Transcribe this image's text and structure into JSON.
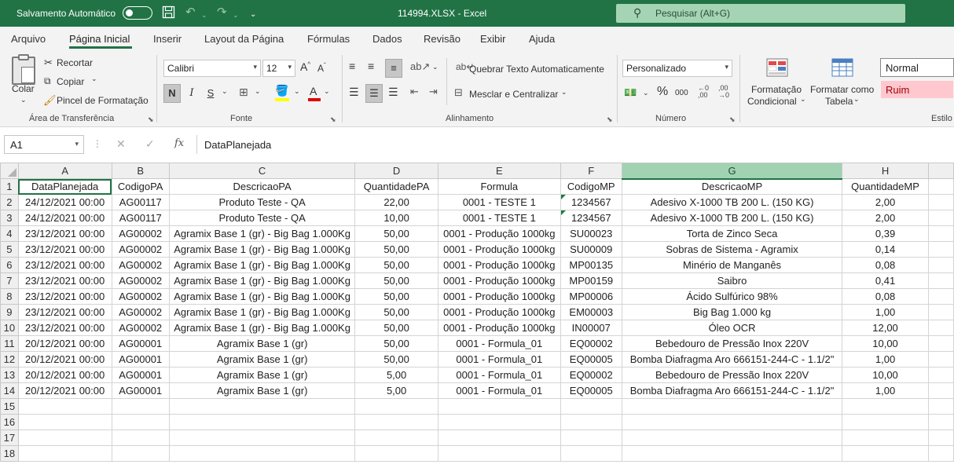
{
  "titlebar": {
    "autosave_label": "Salvamento Automático",
    "file_title": "114994.XLSX  -  Excel",
    "search_placeholder": "Pesquisar (Alt+G)"
  },
  "menu": {
    "tabs": [
      "Arquivo",
      "Página Inicial",
      "Inserir",
      "Layout da Página",
      "Fórmulas",
      "Dados",
      "Revisão",
      "Exibir",
      "Ajuda"
    ],
    "active": "Página Inicial"
  },
  "ribbon": {
    "clipboard": {
      "paste": "Colar",
      "cut": "Recortar",
      "copy": "Copiar",
      "format_painter": "Pincel de Formatação",
      "label": "Área de Transferência"
    },
    "font": {
      "name": "Calibri",
      "size": "12",
      "grow": "A",
      "shrink": "A",
      "bold": "N",
      "italic": "I",
      "underline": "S",
      "font_color_letter": "A",
      "label": "Fonte"
    },
    "alignment": {
      "wrap_text": "Quebrar Texto Automaticamente",
      "merge_center": "Mesclar e Centralizar",
      "label": "Alinhamento"
    },
    "number": {
      "format": "Personalizado",
      "percent": "%",
      "thousands": "000",
      "label": "Número"
    },
    "styles": {
      "conditional_line1": "Formatação",
      "conditional_line2": "Condicional",
      "table_line1": "Formatar como",
      "table_line2": "Tabela",
      "normal": "Normal",
      "bad": "Ruim",
      "label": "Estilo"
    }
  },
  "formula_bar": {
    "cell_ref": "A1",
    "fx": "fx",
    "value": "DataPlanejada"
  },
  "sheet": {
    "columns": [
      "A",
      "B",
      "C",
      "D",
      "E",
      "F",
      "G",
      "H"
    ],
    "selected_column": "G",
    "row_numbers": [
      "1",
      "2",
      "3",
      "4",
      "5",
      "6",
      "7",
      "8",
      "9",
      "10",
      "11",
      "12",
      "13",
      "14",
      "15",
      "16",
      "17",
      "18"
    ],
    "headers": [
      "DataPlanejada",
      "CodigoPA",
      "DescricaoPA",
      "QuantidadePA",
      "Formula",
      "CodigoMP",
      "DescricaoMP",
      "QuantidadeMP"
    ],
    "rows": [
      [
        "24/12/2021 00:00",
        "AG00117",
        "Produto Teste - QA",
        "22,00",
        "0001 - TESTE 1",
        "1234567",
        "Adesivo X-1000 TB 200 L. (150 KG)",
        "2,00"
      ],
      [
        "24/12/2021 00:00",
        "AG00117",
        "Produto Teste - QA",
        "10,00",
        "0001 - TESTE 1",
        "1234567",
        "Adesivo X-1000 TB 200 L. (150 KG)",
        "2,00"
      ],
      [
        "23/12/2021 00:00",
        "AG00002",
        "Agramix Base 1 (gr) - Big Bag 1.000Kg",
        "50,00",
        "0001 - Produção 1000kg",
        "SU00023",
        "Torta de Zinco Seca",
        "0,39"
      ],
      [
        "23/12/2021 00:00",
        "AG00002",
        "Agramix Base 1 (gr) - Big Bag 1.000Kg",
        "50,00",
        "0001 - Produção 1000kg",
        "SU00009",
        "Sobras de Sistema - Agramix",
        "0,14"
      ],
      [
        "23/12/2021 00:00",
        "AG00002",
        "Agramix Base 1 (gr) - Big Bag 1.000Kg",
        "50,00",
        "0001 - Produção 1000kg",
        "MP00135",
        "Minério de Manganês",
        "0,08"
      ],
      [
        "23/12/2021 00:00",
        "AG00002",
        "Agramix Base 1 (gr) - Big Bag 1.000Kg",
        "50,00",
        "0001 - Produção 1000kg",
        "MP00159",
        "Saibro",
        "0,41"
      ],
      [
        "23/12/2021 00:00",
        "AG00002",
        "Agramix Base 1 (gr) - Big Bag 1.000Kg",
        "50,00",
        "0001 - Produção 1000kg",
        "MP00006",
        "Ácido Sulfúrico 98%",
        "0,08"
      ],
      [
        "23/12/2021 00:00",
        "AG00002",
        "Agramix Base 1 (gr) - Big Bag 1.000Kg",
        "50,00",
        "0001 - Produção 1000kg",
        "EM00003",
        "Big Bag 1.000 kg",
        "1,00"
      ],
      [
        "23/12/2021 00:00",
        "AG00002",
        "Agramix Base 1 (gr) - Big Bag 1.000Kg",
        "50,00",
        "0001 - Produção 1000kg",
        "IN00007",
        "Óleo OCR",
        "12,00"
      ],
      [
        "20/12/2021 00:00",
        "AG00001",
        "Agramix Base 1 (gr)",
        "50,00",
        "0001 - Formula_01",
        "EQ00002",
        "Bebedouro de Pressão Inox 220V",
        "10,00"
      ],
      [
        "20/12/2021 00:00",
        "AG00001",
        "Agramix Base 1 (gr)",
        "50,00",
        "0001 - Formula_01",
        "EQ00005",
        "Bomba Diafragma Aro 666151-244-C - 1.1/2\"",
        "1,00"
      ],
      [
        "20/12/2021 00:00",
        "AG00001",
        "Agramix Base 1 (gr)",
        "5,00",
        "0001 - Formula_01",
        "EQ00002",
        "Bebedouro de Pressão Inox 220V",
        "10,00"
      ],
      [
        "20/12/2021 00:00",
        "AG00001",
        "Agramix Base 1 (gr)",
        "5,00",
        "0001 - Formula_01",
        "EQ00005",
        "Bomba Diafragma Aro 666151-244-C - 1.1/2\"",
        "1,00"
      ]
    ]
  },
  "colors": {
    "excel_green": "#217346",
    "search_bg": "#a5d4b5",
    "selected_col_header": "#a1d3b3",
    "bad_style_bg": "#ffc7ce",
    "bad_style_text": "#9c0006"
  }
}
